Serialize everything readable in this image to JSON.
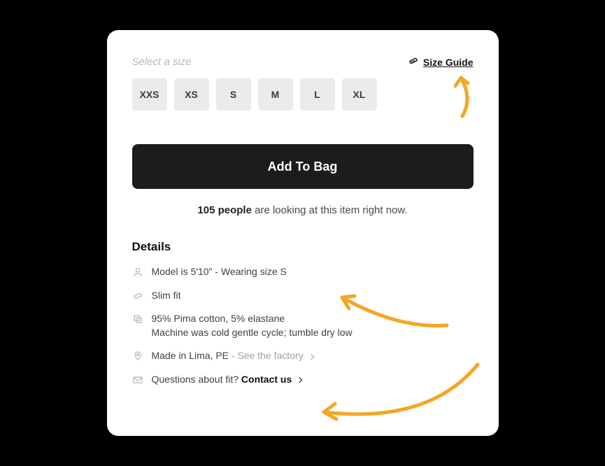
{
  "sizeSection": {
    "label": "Select a size",
    "guide": "Size Guide",
    "options": [
      "XXS",
      "XS",
      "S",
      "M",
      "L",
      "XL"
    ]
  },
  "cta": "Add To Bag",
  "viewers": {
    "count": "105 people",
    "suffix": " are looking at this item right now."
  },
  "details": {
    "heading": "Details",
    "model": "Model is 5'10\" - Wearing size S",
    "fit": "Slim fit",
    "fabric": "95% Pima cotton, 5% elastane",
    "care": "Machine was cold gentle cycle; tumble dry low",
    "origin_prefix": "Made in Lima, PE ",
    "origin_link": "- See the factory",
    "contact_prefix": "Questions about fit? ",
    "contact_link": "Contact us"
  }
}
